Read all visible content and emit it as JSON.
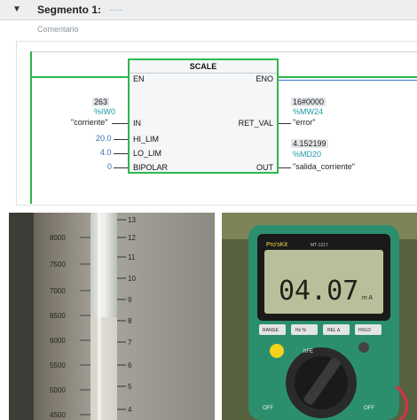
{
  "header": {
    "arrow": "▼",
    "title": "Segmento 1:",
    "dots": "....."
  },
  "comment": "Comentario",
  "block": {
    "title": "SCALE",
    "pins": {
      "en": "EN",
      "eno": "ENO",
      "in": "IN",
      "hi": "HI_LIM",
      "lo": "LO_LIM",
      "bipolar": "BIPOLAR",
      "retval": "RET_VAL",
      "out": "OUT"
    }
  },
  "inputs": {
    "in_value": "263",
    "in_address": "%IW0",
    "in_tag": "\"corriente\"",
    "hi_lim": "20.0",
    "lo_lim": "4.0",
    "bipolar": "0"
  },
  "outputs": {
    "retval_value": "16#0000",
    "retval_address": "%MW24",
    "retval_tag": "\"error\"",
    "out_value": "4.152199",
    "out_address": "%MD20",
    "out_tag": "\"salida_corriente\""
  },
  "photo_left": {
    "scale_left": [
      "8000",
      "7500",
      "7000",
      "6500",
      "6000",
      "5500",
      "5000",
      "4500"
    ],
    "scale_right": [
      "13",
      "12",
      "11",
      "10",
      "9",
      "8",
      "7",
      "6",
      "5",
      "4"
    ]
  },
  "photo_right": {
    "brand": "Pro'sKit",
    "model": "MT-1217",
    "reading": "04.07",
    "unit": "m A",
    "buttons": [
      "RANGE",
      "Hz %",
      "REL Δ",
      "HOLD"
    ],
    "dial": [
      "hFE",
      "OFF",
      "OFF"
    ],
    "colors": {
      "body": "#2b8f6e",
      "display": "#b9bf9a",
      "dial": "#222222"
    }
  },
  "colors": {
    "wire_power": "#2db84d",
    "wire_signal": "#3d7ac7",
    "address": "#1d9aa5",
    "constant": "#3a6fb0"
  }
}
